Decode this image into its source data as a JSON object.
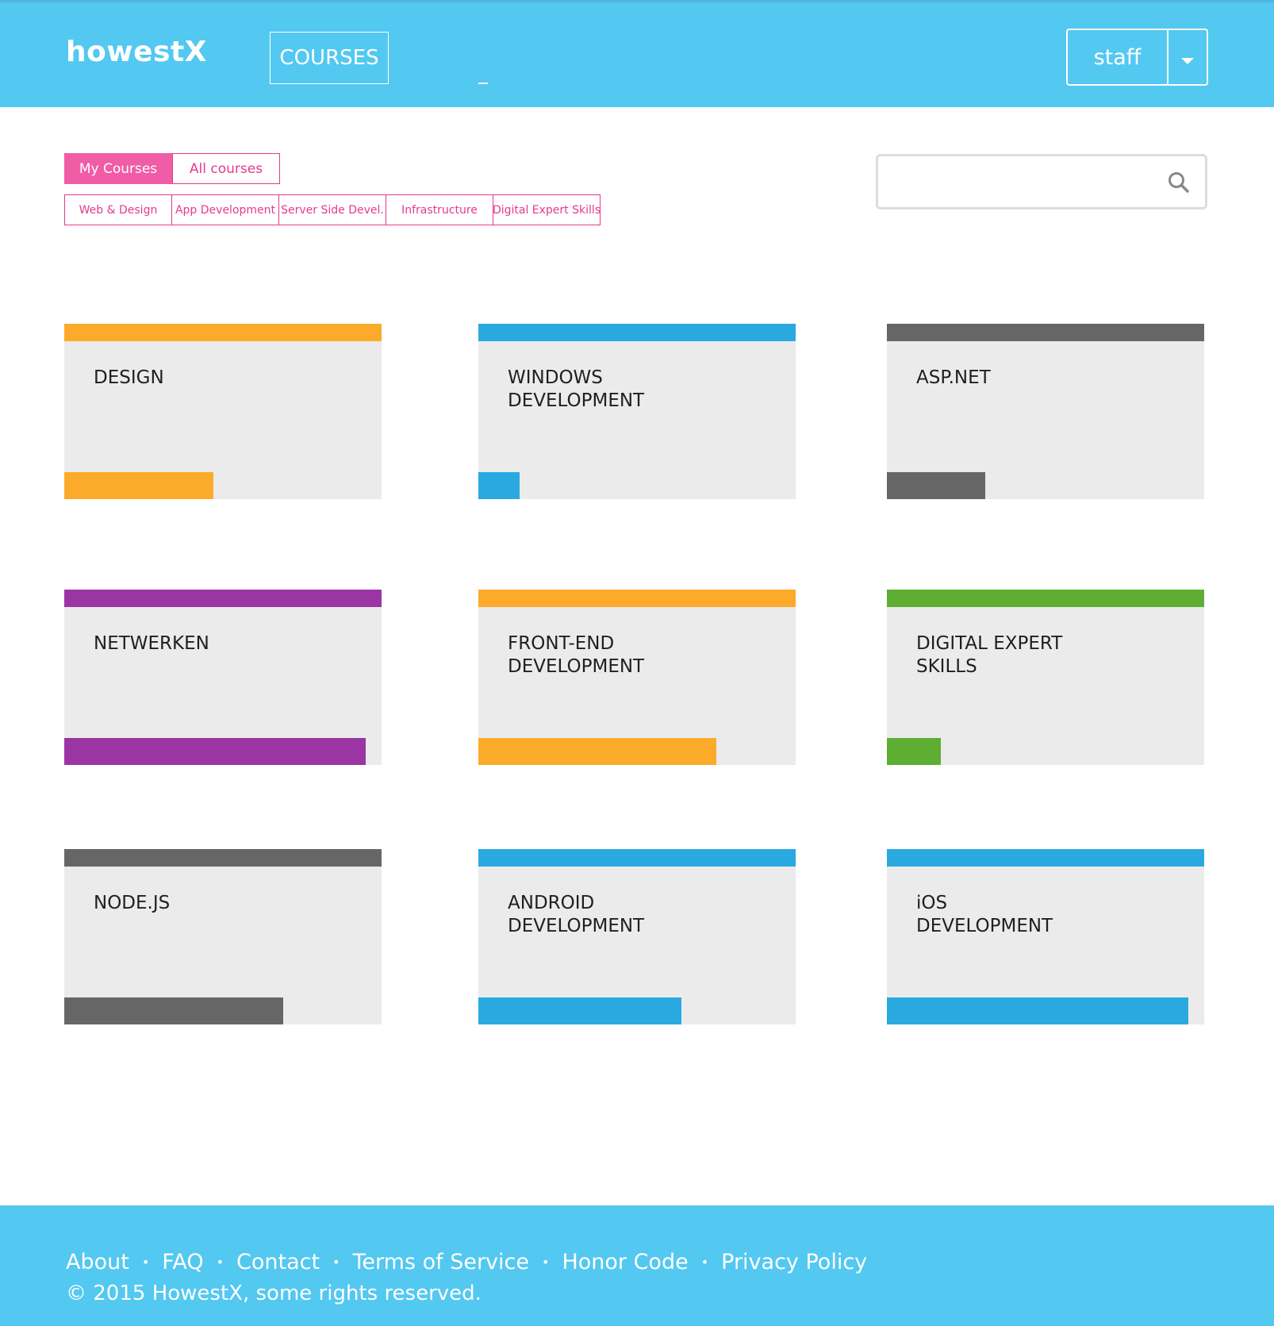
{
  "header": {
    "logo": "howestX",
    "nav_courses": "COURSES",
    "user_name": "staff"
  },
  "filters": {
    "scope": [
      "My Courses",
      "All courses"
    ],
    "categories": [
      "Web & Design",
      "App Development",
      "Server Side Devel.",
      "Infrastructure",
      "Digital Expert Skills"
    ]
  },
  "search": {
    "placeholder": "",
    "value": ""
  },
  "courses": [
    {
      "title": "DESIGN",
      "color": "#fbab29",
      "progress": 0.47
    },
    {
      "title": "WINDOWS\nDEVELOPMENT",
      "color": "#2aa9e0",
      "progress": 0.13
    },
    {
      "title": "ASP.NET",
      "color": "#666666",
      "progress": 0.31
    },
    {
      "title": "NETWERKEN",
      "color": "#9b35a3",
      "progress": 0.95
    },
    {
      "title": "FRONT-END\nDEVELOPMENT",
      "color": "#fbab29",
      "progress": 0.75
    },
    {
      "title": "DIGITAL EXPERT\nSKILLS",
      "color": "#5dae33",
      "progress": 0.17
    },
    {
      "title": "NODE.JS",
      "color": "#666666",
      "progress": 0.69
    },
    {
      "title": "ANDROID\nDEVELOPMENT",
      "color": "#2aa9e0",
      "progress": 0.64
    },
    {
      "title": "iOS\nDEVELOPMENT",
      "color": "#2aa9e0",
      "progress": 0.95
    }
  ],
  "footer": {
    "links": [
      "About",
      "FAQ",
      "Contact",
      "Terms of Service",
      "Honor Code",
      "Privacy Policy"
    ],
    "separator": "•",
    "copyright": "© 2015 HowestX, some rights reserved."
  },
  "colors": {
    "header_bg": "#53c8f1",
    "accent_pink": "#e5398e",
    "active_pink": "#f05ca6",
    "card_bg": "#ebebeb"
  }
}
